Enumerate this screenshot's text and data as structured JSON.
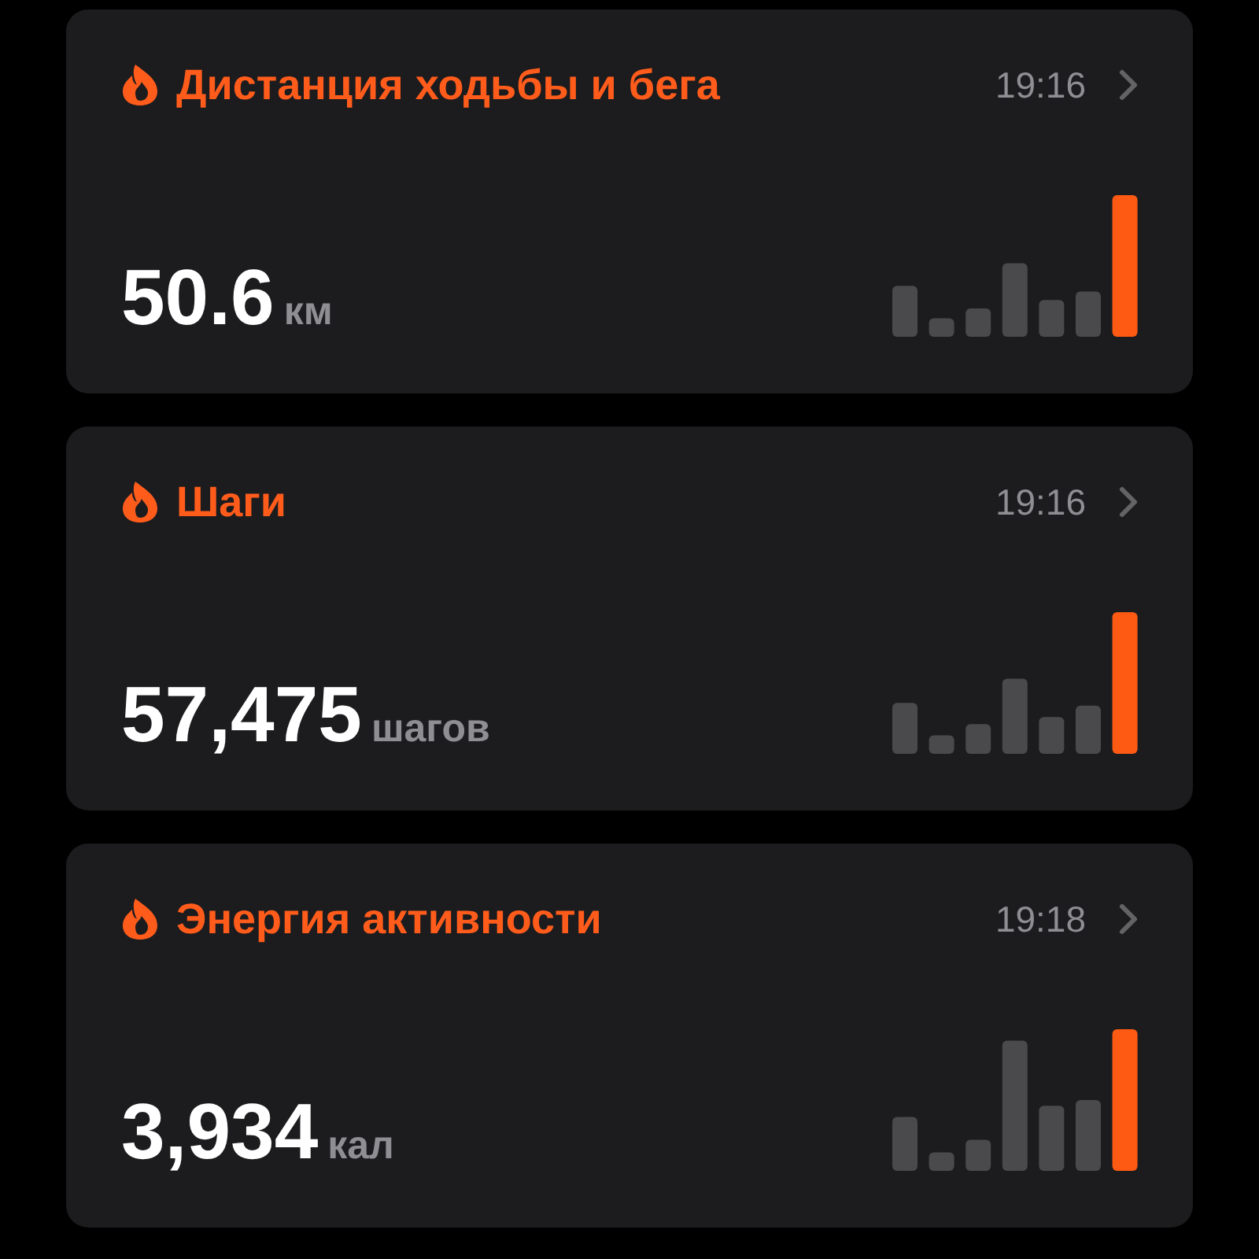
{
  "cards": [
    {
      "title": "Дистанция ходьбы и бега",
      "time": "19:16",
      "value": "50.6",
      "unit": "км"
    },
    {
      "title": "Шаги",
      "time": "19:16",
      "value": "57,475",
      "unit": "шагов"
    },
    {
      "title": "Энергия активности",
      "time": "19:18",
      "value": "3,934",
      "unit": "кал"
    }
  ]
}
